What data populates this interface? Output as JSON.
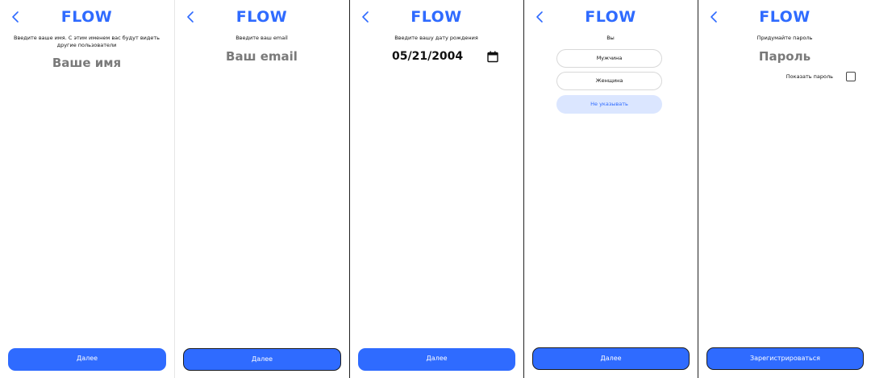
{
  "app": {
    "logo": "FLOW",
    "accent_color": "#2f6bff"
  },
  "screens": {
    "name": {
      "prompt": "Введите ваше имя. С этим именем вас будут видеть другие пользователи",
      "placeholder": "Ваше имя",
      "button": "Далее"
    },
    "email": {
      "prompt": "Введите ваш email",
      "placeholder": "Ваш email",
      "button": "Далее"
    },
    "birthdate": {
      "prompt": "Введите вашу дату рождения",
      "value": "05/21/2004",
      "button": "Далее"
    },
    "gender": {
      "prompt": "Вы",
      "options": [
        "Мужчина",
        "Женщина",
        "Не указывать"
      ],
      "selected": "Не указывать",
      "button": "Далее"
    },
    "password": {
      "prompt": "Придумайте пароль",
      "placeholder": "Пароль",
      "show_password_label": "Показать пароль",
      "button": "Зарегистрироваться"
    }
  },
  "icons": {
    "back": "chevron-left-icon",
    "calendar": "calendar-icon"
  }
}
